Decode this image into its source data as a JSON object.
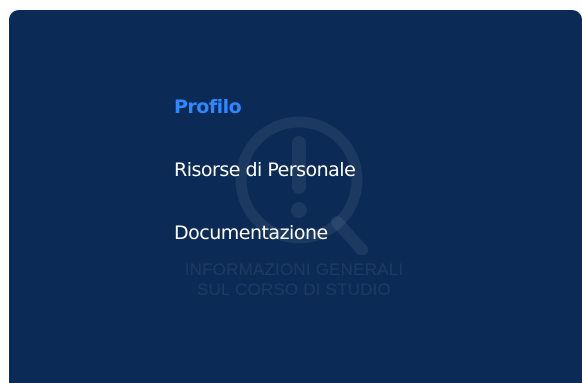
{
  "menu": {
    "items": [
      {
        "label": "Profilo",
        "active": true
      },
      {
        "label": "Risorse di Personale",
        "active": false
      },
      {
        "label": "Documentazione",
        "active": false
      }
    ]
  },
  "watermark": {
    "icon": "info-exclamation-icon",
    "line1": "INFORMAZIONI GENERALI",
    "line2": "SUL CORSO DI STUDIO"
  },
  "colors": {
    "panel_background": "#0b2a55",
    "active_item": "#2f86ff",
    "item_text": "#ffffff"
  }
}
